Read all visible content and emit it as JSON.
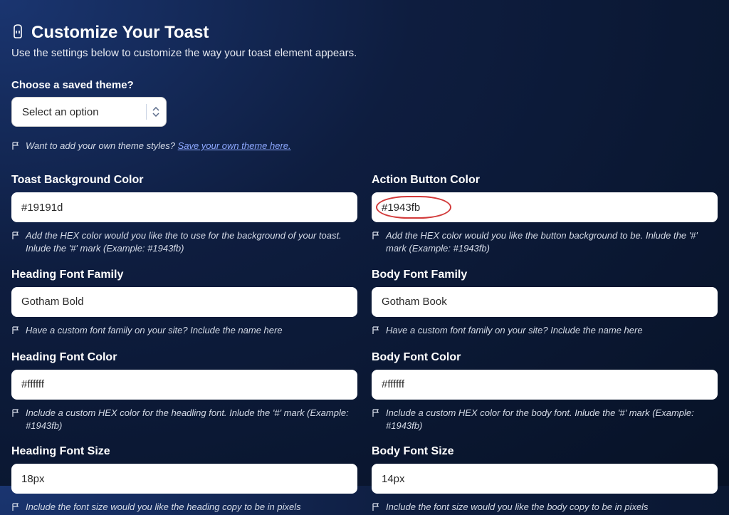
{
  "header": {
    "title": "Customize Your Toast",
    "subtitle": "Use the settings below to customize the way your toast element appears."
  },
  "theme": {
    "label": "Choose a saved theme?",
    "placeholder": "Select an option",
    "hint_prefix": "Want to add your own theme styles? ",
    "hint_link": "Save your own theme here."
  },
  "fields": {
    "bg_color": {
      "label": "Toast Background Color",
      "value": "#19191d",
      "hint": "Add the HEX color would you like the to use for the background of your toast. Inlude the '#' mark (Example: #1943fb)"
    },
    "action_color": {
      "label": "Action Button Color",
      "value": "#1943fb",
      "hint": "Add the HEX color would you like the button background to be. Inlude the '#' mark (Example: #1943fb)"
    },
    "heading_font": {
      "label": "Heading Font Family",
      "value": "Gotham Bold",
      "hint": "Have a custom font family on your site? Include the name here"
    },
    "body_font": {
      "label": "Body Font Family",
      "value": "Gotham Book",
      "hint": "Have a custom font family on your site? Include the name here"
    },
    "heading_color": {
      "label": "Heading Font Color",
      "value": "#ffffff",
      "hint": "Include a custom HEX color for the headling font. Inlude the '#' mark (Example: #1943fb)"
    },
    "body_color": {
      "label": "Body Font Color",
      "value": "#ffffff",
      "hint": "Include a custom HEX color for the body font. Inlude the '#' mark (Example: #1943fb)"
    },
    "heading_size": {
      "label": "Heading Font Size",
      "value": "18px",
      "hint": "Include the font size would you like the heading copy to be in pixels"
    },
    "body_size": {
      "label": "Body Font Size",
      "value": "14px",
      "hint": "Include the font size would you like the body copy to be in pixels"
    }
  }
}
